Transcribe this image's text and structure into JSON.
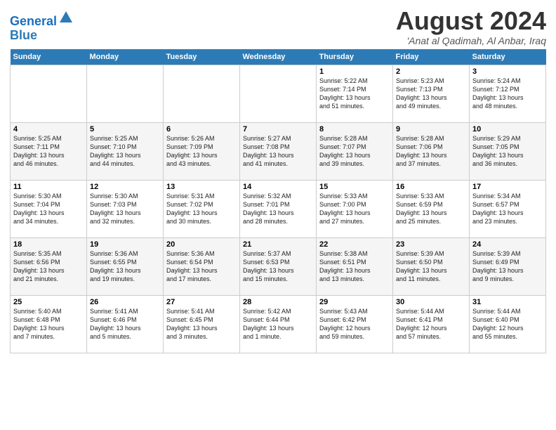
{
  "header": {
    "logo_line1": "General",
    "logo_line2": "Blue",
    "month": "August 2024",
    "location": "'Anat al Qadimah, Al Anbar, Iraq"
  },
  "columns": [
    "Sunday",
    "Monday",
    "Tuesday",
    "Wednesday",
    "Thursday",
    "Friday",
    "Saturday"
  ],
  "weeks": [
    [
      {
        "day": "",
        "detail": ""
      },
      {
        "day": "",
        "detail": ""
      },
      {
        "day": "",
        "detail": ""
      },
      {
        "day": "",
        "detail": ""
      },
      {
        "day": "1",
        "detail": "Sunrise: 5:22 AM\nSunset: 7:14 PM\nDaylight: 13 hours\nand 51 minutes."
      },
      {
        "day": "2",
        "detail": "Sunrise: 5:23 AM\nSunset: 7:13 PM\nDaylight: 13 hours\nand 49 minutes."
      },
      {
        "day": "3",
        "detail": "Sunrise: 5:24 AM\nSunset: 7:12 PM\nDaylight: 13 hours\nand 48 minutes."
      }
    ],
    [
      {
        "day": "4",
        "detail": "Sunrise: 5:25 AM\nSunset: 7:11 PM\nDaylight: 13 hours\nand 46 minutes."
      },
      {
        "day": "5",
        "detail": "Sunrise: 5:25 AM\nSunset: 7:10 PM\nDaylight: 13 hours\nand 44 minutes."
      },
      {
        "day": "6",
        "detail": "Sunrise: 5:26 AM\nSunset: 7:09 PM\nDaylight: 13 hours\nand 43 minutes."
      },
      {
        "day": "7",
        "detail": "Sunrise: 5:27 AM\nSunset: 7:08 PM\nDaylight: 13 hours\nand 41 minutes."
      },
      {
        "day": "8",
        "detail": "Sunrise: 5:28 AM\nSunset: 7:07 PM\nDaylight: 13 hours\nand 39 minutes."
      },
      {
        "day": "9",
        "detail": "Sunrise: 5:28 AM\nSunset: 7:06 PM\nDaylight: 13 hours\nand 37 minutes."
      },
      {
        "day": "10",
        "detail": "Sunrise: 5:29 AM\nSunset: 7:05 PM\nDaylight: 13 hours\nand 36 minutes."
      }
    ],
    [
      {
        "day": "11",
        "detail": "Sunrise: 5:30 AM\nSunset: 7:04 PM\nDaylight: 13 hours\nand 34 minutes."
      },
      {
        "day": "12",
        "detail": "Sunrise: 5:30 AM\nSunset: 7:03 PM\nDaylight: 13 hours\nand 32 minutes."
      },
      {
        "day": "13",
        "detail": "Sunrise: 5:31 AM\nSunset: 7:02 PM\nDaylight: 13 hours\nand 30 minutes."
      },
      {
        "day": "14",
        "detail": "Sunrise: 5:32 AM\nSunset: 7:01 PM\nDaylight: 13 hours\nand 28 minutes."
      },
      {
        "day": "15",
        "detail": "Sunrise: 5:33 AM\nSunset: 7:00 PM\nDaylight: 13 hours\nand 27 minutes."
      },
      {
        "day": "16",
        "detail": "Sunrise: 5:33 AM\nSunset: 6:59 PM\nDaylight: 13 hours\nand 25 minutes."
      },
      {
        "day": "17",
        "detail": "Sunrise: 5:34 AM\nSunset: 6:57 PM\nDaylight: 13 hours\nand 23 minutes."
      }
    ],
    [
      {
        "day": "18",
        "detail": "Sunrise: 5:35 AM\nSunset: 6:56 PM\nDaylight: 13 hours\nand 21 minutes."
      },
      {
        "day": "19",
        "detail": "Sunrise: 5:36 AM\nSunset: 6:55 PM\nDaylight: 13 hours\nand 19 minutes."
      },
      {
        "day": "20",
        "detail": "Sunrise: 5:36 AM\nSunset: 6:54 PM\nDaylight: 13 hours\nand 17 minutes."
      },
      {
        "day": "21",
        "detail": "Sunrise: 5:37 AM\nSunset: 6:53 PM\nDaylight: 13 hours\nand 15 minutes."
      },
      {
        "day": "22",
        "detail": "Sunrise: 5:38 AM\nSunset: 6:51 PM\nDaylight: 13 hours\nand 13 minutes."
      },
      {
        "day": "23",
        "detail": "Sunrise: 5:39 AM\nSunset: 6:50 PM\nDaylight: 13 hours\nand 11 minutes."
      },
      {
        "day": "24",
        "detail": "Sunrise: 5:39 AM\nSunset: 6:49 PM\nDaylight: 13 hours\nand 9 minutes."
      }
    ],
    [
      {
        "day": "25",
        "detail": "Sunrise: 5:40 AM\nSunset: 6:48 PM\nDaylight: 13 hours\nand 7 minutes."
      },
      {
        "day": "26",
        "detail": "Sunrise: 5:41 AM\nSunset: 6:46 PM\nDaylight: 13 hours\nand 5 minutes."
      },
      {
        "day": "27",
        "detail": "Sunrise: 5:41 AM\nSunset: 6:45 PM\nDaylight: 13 hours\nand 3 minutes."
      },
      {
        "day": "28",
        "detail": "Sunrise: 5:42 AM\nSunset: 6:44 PM\nDaylight: 13 hours\nand 1 minute."
      },
      {
        "day": "29",
        "detail": "Sunrise: 5:43 AM\nSunset: 6:42 PM\nDaylight: 12 hours\nand 59 minutes."
      },
      {
        "day": "30",
        "detail": "Sunrise: 5:44 AM\nSunset: 6:41 PM\nDaylight: 12 hours\nand 57 minutes."
      },
      {
        "day": "31",
        "detail": "Sunrise: 5:44 AM\nSunset: 6:40 PM\nDaylight: 12 hours\nand 55 minutes."
      }
    ]
  ]
}
